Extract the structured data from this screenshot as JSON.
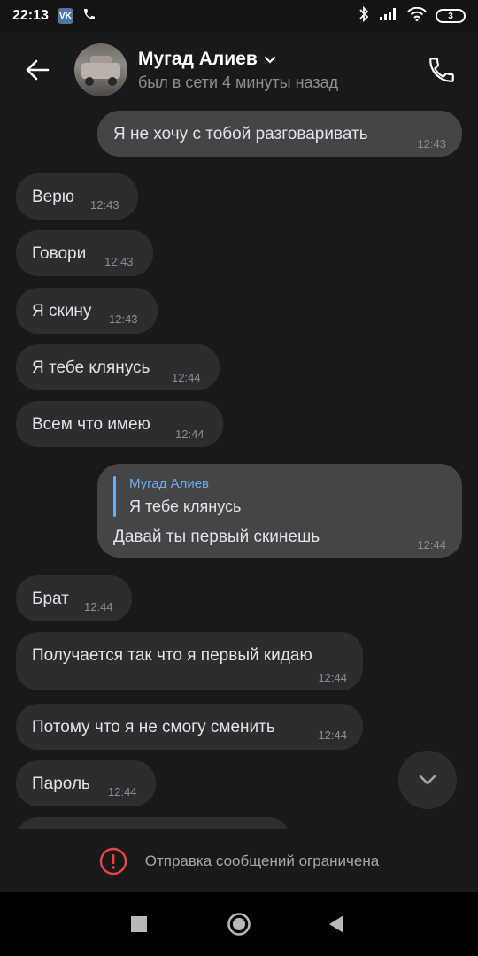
{
  "status_bar": {
    "time": "22:13",
    "vk_badge": "VK",
    "battery": "3",
    "icons": [
      "vk-icon",
      "phone-icon",
      "bluetooth-icon",
      "signal-icon",
      "wifi-icon",
      "battery-icon"
    ]
  },
  "header": {
    "contact_name": "Мугад Алиев",
    "contact_status": "был в сети 4 минуты назад",
    "icons": [
      "back-arrow-icon",
      "chevron-down-icon",
      "phone-call-icon"
    ]
  },
  "messages": [
    {
      "direction": "out",
      "text": "Я не хочу  с тобой разговаривать",
      "time": "12:43"
    },
    {
      "direction": "in",
      "text": "Верю",
      "time": "12:43"
    },
    {
      "direction": "in",
      "text": "Говори",
      "time": "12:43"
    },
    {
      "direction": "in",
      "text": "Я скину",
      "time": "12:43"
    },
    {
      "direction": "in",
      "text": "Я тебе клянусь",
      "time": "12:44"
    },
    {
      "direction": "in",
      "text": "Всем что имею",
      "time": "12:44"
    },
    {
      "direction": "out",
      "reply_author": "Мугад Алиев",
      "reply_text": "Я тебе клянусь",
      "text": "Давай ты первый скинешь",
      "time": "12:44"
    },
    {
      "direction": "in",
      "text": "Брат",
      "time": "12:44"
    },
    {
      "direction": "in",
      "text": "Получается так что я первый кидаю",
      "time": "12:44"
    },
    {
      "direction": "in",
      "text": "Потому что я не смогу сменить",
      "time": "12:44"
    },
    {
      "direction": "in",
      "text": "Пароль",
      "time": "12:44"
    }
  ],
  "restricted_notice": {
    "text": "Отправка сообщений ограничена",
    "icon": "warning-circle-icon",
    "accent_color": "#e64646"
  },
  "nav_bar": {
    "icons": [
      "recents-square-icon",
      "home-circle-icon",
      "back-triangle-icon"
    ]
  },
  "colors": {
    "background": "#19191a",
    "incoming_bubble": "#2c2d2e",
    "outgoing_bubble": "#444547",
    "reply_accent": "#71aaeb"
  }
}
